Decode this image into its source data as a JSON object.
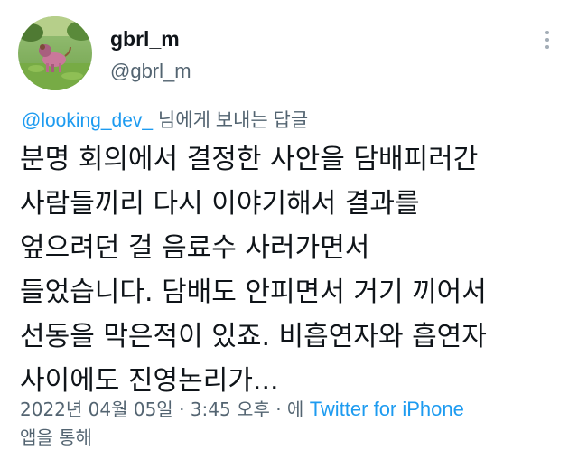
{
  "tweet": {
    "display_name": "gbrl_m",
    "handle": "@gbrl_m",
    "more_icon": "more-dots-vertical-icon",
    "reply": {
      "mention": "@looking_dev_",
      "suffix": " 님에게 보내는 답글"
    },
    "body_lines": [
      "분명 회의에서 결정한 사안을 담배피러간",
      "사람들끼리 다시 이야기해서 결과를",
      "엎으려던 걸 음료수 사러가면서",
      "들었습니다. 담배도 안피면서 거기 끼어서",
      "선동을 막은적이 있죠. 비흡연자와 흡연자",
      "사이에도 진영논리가..."
    ],
    "meta": {
      "timestamp": "2022년 04월 05일 · 3:45 오후 · 에 ",
      "source": "Twitter for iPhone",
      "suffix": "앱을 통해"
    }
  },
  "colors": {
    "text": "#0f1419",
    "secondary": "#536471",
    "accent": "#1d9bf0"
  }
}
